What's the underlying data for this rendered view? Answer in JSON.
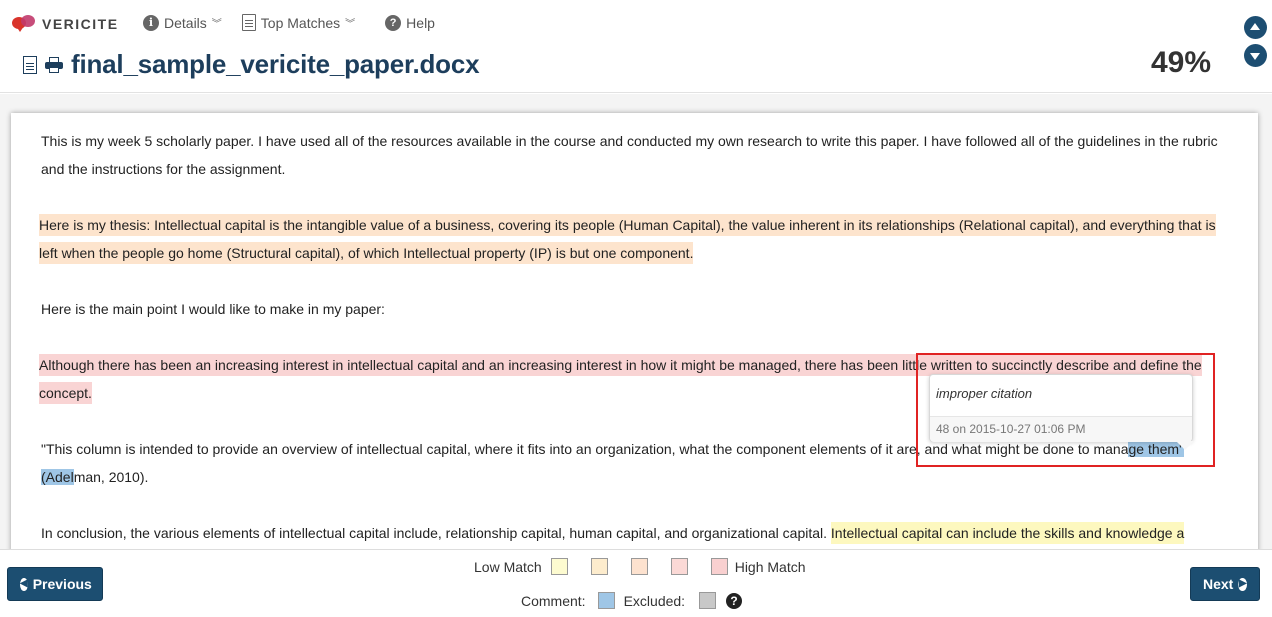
{
  "brand": {
    "name": "VERICITE"
  },
  "nav": {
    "details": "Details",
    "top_matches": "Top Matches",
    "help": "Help"
  },
  "document": {
    "title": "final_sample_vericite_paper.docx",
    "score": "49%"
  },
  "content": {
    "p1": "This is my week 5 scholarly paper.    I have used all of the resources available in the course and conducted my own research to write this paper.      I have followed all of the guidelines in the rubric and the instructions for the assignment.",
    "p2": "Here is my thesis: Intellectual capital is the intangible value of a business, covering its people (Human Capital), the value inherent in its relationships (Relational capital), and everything that is left when the people go home (Structural capital), of which Intellectual property (IP) is but one component. ",
    "p3": "Here is the main point I would like to make in my paper:",
    "p4": "Although there has been an increasing interest in intellectual capital and an increasing interest in how it might be managed, there has been little written to succinctly describe and define the concept. ",
    "p5_pre": " \"This column is intended to provide an overview of intellectual capital, where it fits into an organization, what the component elements of it are, and what might be done to mana",
    "p5_hl1": "ge them\"",
    "p5_mid": " ",
    "p5_hl2": "(Adel",
    "p5_post": "man, 2010).",
    "p6_pre": "In conclusion, the various elements of intellectual capital include, relationship capital, human capital, and organizational capital.  ",
    "p6_hl": " Intellectual capital can include the skills and knowledge a"
  },
  "comment_popup": {
    "text": "improper citation",
    "meta": "48 on 2015-10-27 01:06 PM"
  },
  "footer": {
    "previous": "Previous",
    "next": "Next",
    "low_match": "Low Match",
    "high_match": "High Match",
    "comment": "Comment:",
    "excluded": "Excluded:"
  },
  "colors": {
    "match_levels": [
      "#fdfbd0",
      "#fdeccd",
      "#fde2cf",
      "#fbd9d6",
      "#f9d0d0"
    ],
    "comment": "#9fc6e6",
    "excluded": "#c8c8c8",
    "accent": "#1c4e71"
  }
}
